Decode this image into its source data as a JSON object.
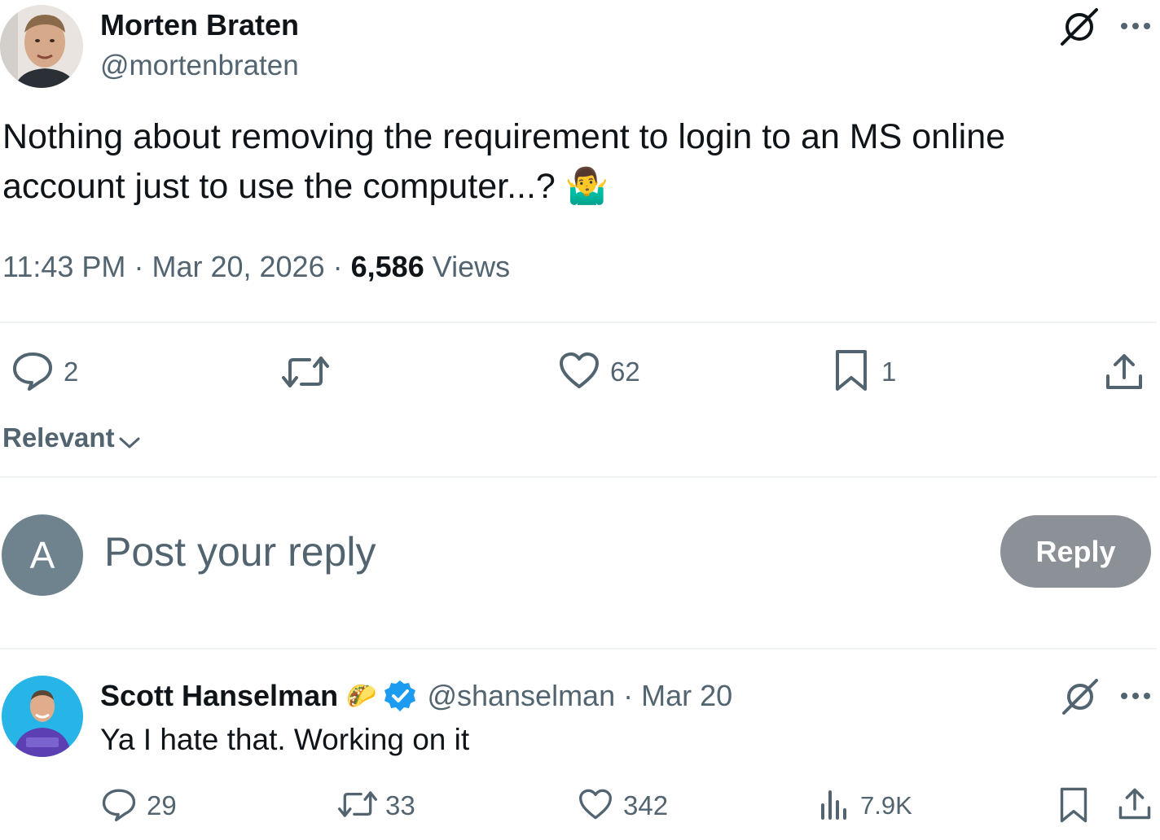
{
  "post": {
    "author_name": "Morten Braten",
    "author_handle": "@mortenbraten",
    "text": "Nothing about removing the requirement to login to an MS online account just to use the computer...?",
    "emoji": "🤷‍♂️",
    "time": "11:43 PM",
    "dot1": "·",
    "date": "Mar 20, 2026",
    "dot2": "·",
    "views_count": "6,586",
    "views_label": "Views",
    "actions": {
      "replies": "2",
      "likes": "62",
      "bookmarks": "1"
    }
  },
  "sort": {
    "label": "Relevant"
  },
  "composer": {
    "avatar_letter": "A",
    "placeholder": "Post your reply",
    "button_label": "Reply"
  },
  "reply": {
    "author_name": "Scott Hanselman",
    "author_emoji": "🌮",
    "author_handle": "@shanselman",
    "dot": "·",
    "date": "Mar 20",
    "text": "Ya I hate that. Working on it",
    "actions": {
      "replies": "29",
      "reposts": "33",
      "likes": "342",
      "views": "7.9K"
    }
  },
  "colors": {
    "text_primary": "#0f1419",
    "text_muted": "#536471",
    "divider": "#eff3f4",
    "verified": "#1d9bf0",
    "reply_button": "#8b9196",
    "avatar_placeholder": "#6f838f"
  },
  "icons": [
    "grok-icon",
    "more-icon",
    "reply-icon",
    "repost-icon",
    "like-icon",
    "bookmark-icon",
    "share-icon",
    "chevron-down-icon",
    "verified-badge-icon",
    "views-icon"
  ]
}
